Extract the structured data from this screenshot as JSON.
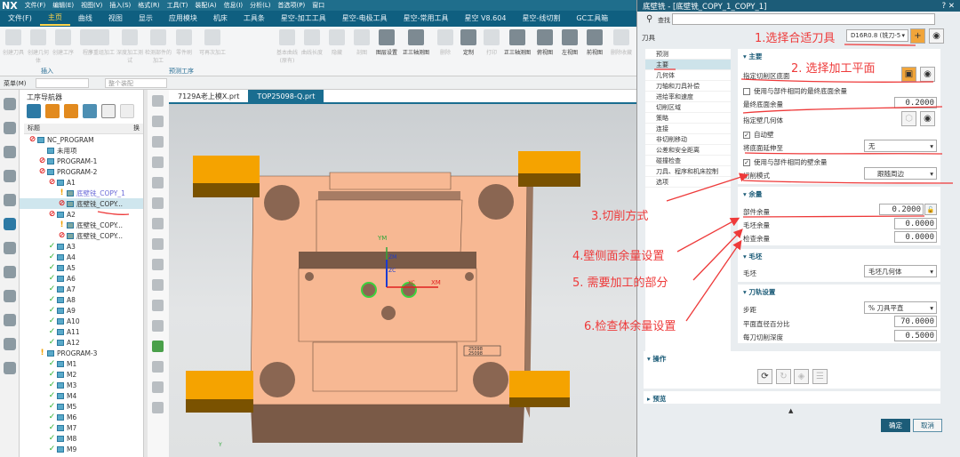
{
  "app": {
    "logo": "NX",
    "menus": [
      "文件(F)",
      "编辑(E)",
      "视图(V)",
      "插入(S)",
      "格式(R)",
      "工具(T)",
      "装配(A)",
      "信息(I)",
      "分析(L)",
      "首选项(P)",
      "窗口"
    ]
  },
  "tabs": [
    "文件(F)",
    "主页",
    "曲线",
    "视图",
    "显示",
    "应用模块",
    "机床",
    "工具条",
    "星空-加工工具",
    "星空-电极工具",
    "星空-常用工具",
    "星空 V8.604",
    "星空-线切割",
    "GC工具箱"
  ],
  "ribbon": {
    "insert": [
      "创建刀具",
      "创建几何体",
      "创建工序",
      "程序"
    ],
    "group_insert": "插入",
    "predict": [
      "多重组加工",
      "深度加工测试",
      "检测部件的加工",
      "零件刷",
      "可再次加工"
    ],
    "group_predict": "预测工序",
    "view": [
      "基本曲线(原有)",
      "曲线长度",
      "隐藏",
      "剖图",
      "图层设置",
      "正三轴测图",
      "删除",
      "定制",
      "打印",
      "正三轴测图",
      "俯视图",
      "左视图",
      "前视图",
      "删除收藏"
    ]
  },
  "toolbar2": {
    "menu": "菜单(M)",
    "filter": "整个装配"
  },
  "navigator": {
    "title": "工序导航器",
    "col_title": "标题",
    "col2": "换",
    "rows": [
      {
        "label": "NC_PROGRAM",
        "lv": 0,
        "st": "red"
      },
      {
        "label": "未用项",
        "lv": 1,
        "st": ""
      },
      {
        "label": "PROGRAM-1",
        "lv": 1,
        "st": "red"
      },
      {
        "label": "PROGRAM-2",
        "lv": 1,
        "st": "red"
      },
      {
        "label": "A1",
        "lv": 2,
        "st": "red"
      },
      {
        "label": "底壁铣_COPY_1",
        "lv": 3,
        "st": "yel",
        "op": true
      },
      {
        "label": "底壁铣_COPY...",
        "lv": 3,
        "st": "red",
        "op": true,
        "sel": true
      },
      {
        "label": "A2",
        "lv": 2,
        "st": "red"
      },
      {
        "label": "底壁铣_COPY...",
        "lv": 3,
        "st": "yel",
        "op": true
      },
      {
        "label": "底壁铣_COPY...",
        "lv": 3,
        "st": "red",
        "op": true
      },
      {
        "label": "A3",
        "lv": 2,
        "st": "grn"
      },
      {
        "label": "A4",
        "lv": 2,
        "st": "grn"
      },
      {
        "label": "A5",
        "lv": 2,
        "st": "grn"
      },
      {
        "label": "A6",
        "lv": 2,
        "st": "grn"
      },
      {
        "label": "A7",
        "lv": 2,
        "st": "grn"
      },
      {
        "label": "A8",
        "lv": 2,
        "st": "grn"
      },
      {
        "label": "A9",
        "lv": 2,
        "st": "grn"
      },
      {
        "label": "A10",
        "lv": 2,
        "st": "grn"
      },
      {
        "label": "A11",
        "lv": 2,
        "st": "grn"
      },
      {
        "label": "A12",
        "lv": 2,
        "st": "grn"
      },
      {
        "label": "PROGRAM-3",
        "lv": 1,
        "st": "yel"
      },
      {
        "label": "M1",
        "lv": 2,
        "st": "grn"
      },
      {
        "label": "M2",
        "lv": 2,
        "st": "grn"
      },
      {
        "label": "M3",
        "lv": 2,
        "st": "grn"
      },
      {
        "label": "M4",
        "lv": 2,
        "st": "grn"
      },
      {
        "label": "M5",
        "lv": 2,
        "st": "grn"
      },
      {
        "label": "M6",
        "lv": 2,
        "st": "grn"
      },
      {
        "label": "M7",
        "lv": 2,
        "st": "grn"
      },
      {
        "label": "M8",
        "lv": 2,
        "st": "grn"
      },
      {
        "label": "M9",
        "lv": 2,
        "st": "grn"
      }
    ]
  },
  "viewport": {
    "tabs": [
      "7129A老上模X.prt",
      "TOP25098-Q.prt"
    ],
    "axes": {
      "ym": "YM",
      "xm": "XM",
      "zm": "ZM",
      "zc": "ZC",
      "xc": "XC",
      "y": "Y"
    },
    "engraving": [
      "25098",
      "25098"
    ]
  },
  "dialog": {
    "title": "底壁铣 - [底壁铣_COPY_1_COPY_1]",
    "help": "?",
    "close": "✕",
    "search_label": "查找",
    "search_value": "",
    "tool_label": "刀具",
    "tool_value": "D16R0.8 (铣刀-5",
    "tree": [
      "预测",
      "主要",
      "几何体",
      "刀轴和刀具补偿",
      "进给率和速度",
      "切削区域",
      "策略",
      "连接",
      "非切削移动",
      "公差和安全距离",
      "碰撞检查",
      "刀具、程序和机床控制",
      "选项"
    ],
    "main": {
      "header": "主要",
      "cut_floor": "指定切削区底面",
      "use_floor_stock": "使用与部件相同的最终底面余量",
      "final_floor_stock_label": "最终底面余量",
      "final_floor_stock": "0.2000",
      "wall_geom": "指定壁几何体",
      "auto_wall": "自动壁",
      "extend_label": "将底面延伸至",
      "extend_value": "无",
      "use_wall_stock": "使用与部件相同的壁余量",
      "cut_pattern_label": "切削模式",
      "cut_pattern_value": "跟随周边"
    },
    "stock": {
      "header": "余量",
      "part_label": "部件余量",
      "part": "0.2000",
      "blank_label": "毛坯余量",
      "blank": "0.0000",
      "check_label": "检查余量",
      "check": "0.0000"
    },
    "blank": {
      "header": "毛坯",
      "label": "毛坯",
      "value": "毛坯几何体"
    },
    "path": {
      "header": "刀轨设置",
      "step_label": "步距",
      "step_value": "% 刀具平直",
      "pct_label": "平面直径百分比",
      "pct": "70.0000",
      "depth_label": "每刀切削深度",
      "depth": "0.5000"
    },
    "ops_header": "操作",
    "preview_header": "预览",
    "ok": "确定",
    "cancel": "取消"
  },
  "annotations": [
    "1.选择合适刀具",
    "2. 选择加工平面",
    "3.切削方式",
    "4.壁侧面余量设置",
    "5. 需要加工的部分",
    "6.检查体余量设置"
  ],
  "colors": {
    "annotation": "#ee3a3a",
    "accent": "#1c5c78",
    "part_top": "#f7b893",
    "part_side": "#7a5a47",
    "clamp": "#f5a300"
  }
}
